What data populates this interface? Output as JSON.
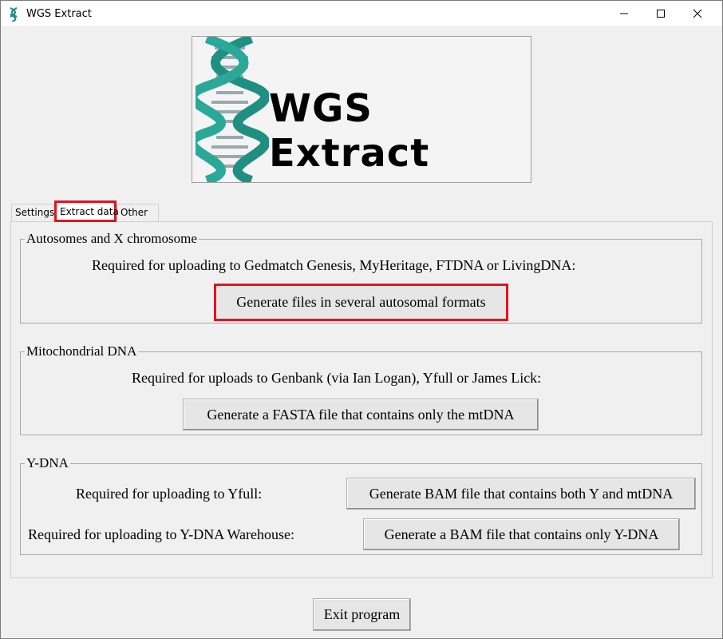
{
  "window": {
    "title": "WGS Extract"
  },
  "logo": {
    "text": "WGS Extract"
  },
  "tabs": [
    {
      "label": "Settings"
    },
    {
      "label": "Extract data"
    },
    {
      "label": "Other"
    }
  ],
  "autosomes": {
    "heading": "Autosomes and X chromosome",
    "description": "Required for uploading to Gedmatch Genesis, MyHeritage, FTDNA or LivingDNA:",
    "button": "Generate files in several autosomal formats"
  },
  "mtdna": {
    "heading": "Mitochondrial DNA",
    "description": "Required for uploads to Genbank (via Ian Logan), Yfull or James Lick:",
    "button": "Generate a FASTA file that contains only the mtDNA"
  },
  "ydna": {
    "heading": "Y-DNA",
    "yfull_label": "Required for uploading to Yfull:",
    "yfull_button": "Generate BAM file that contains both Y and mtDNA",
    "warehouse_label": "Required for uploading to Y-DNA Warehouse:",
    "warehouse_button": "Generate a BAM file that contains only Y-DNA"
  },
  "footer": {
    "exit_button": "Exit program"
  },
  "colors": {
    "highlight": "#e0141e",
    "helix": "#1f8f82"
  }
}
